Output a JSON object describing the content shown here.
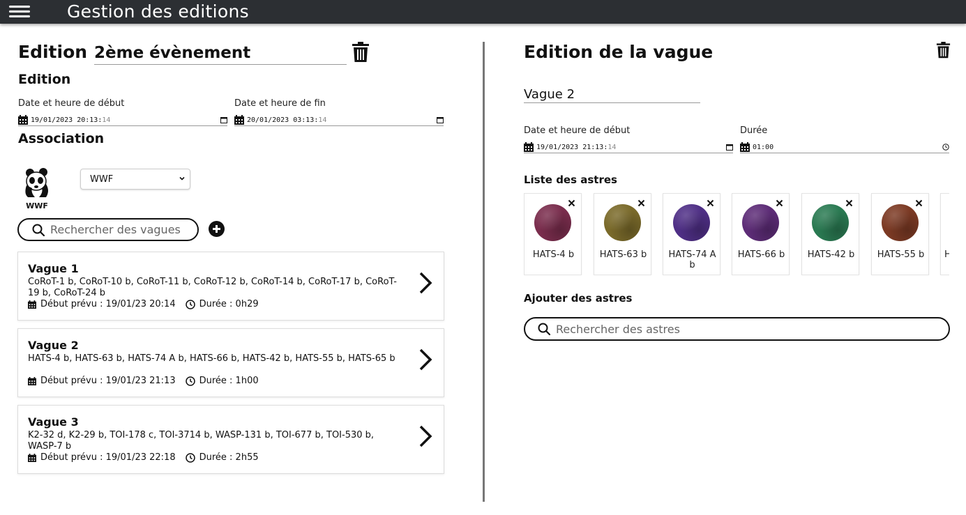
{
  "header": {
    "title": "Gestion des editions"
  },
  "edition": {
    "heading": "Edition",
    "name_value": "2ème évènement",
    "sub_heading": "Edition",
    "start_label": "Date et heure de début",
    "start_value": "19/01/2023 20:13:",
    "start_seconds": "14",
    "end_label": "Date et heure de fin",
    "end_value": "20/01/2023 03:13:",
    "end_seconds": "14"
  },
  "association": {
    "heading": "Association",
    "logo_text": "WWF",
    "selected": "WWF"
  },
  "wave_search": {
    "placeholder": "Rechercher des vagues"
  },
  "waves": [
    {
      "title": "Vague 1",
      "astres": "CoRoT-1 b, CoRoT-10 b, CoRoT-11 b, CoRoT-12 b, CoRoT-14 b, CoRoT-17 b, CoRoT-19 b, CoRoT-24 b",
      "start": "Début prévu : 19/01/23 20:14",
      "duration": "Durée : 0h29"
    },
    {
      "title": "Vague 2",
      "astres": "HATS-4 b, HATS-63 b, HATS-74 A b, HATS-66 b, HATS-42 b, HATS-55 b, HATS-65 b",
      "start": "Début prévu : 19/01/23 21:13",
      "duration": "Durée : 1h00"
    },
    {
      "title": "Vague 3",
      "astres": "K2-32 d, K2-29 b, TOI-178 c, TOI-3714 b, WASP-131 b, TOI-677 b, TOI-530 b, WASP-7 b",
      "start": "Début prévu : 19/01/23 22:18",
      "duration": "Durée : 2h55"
    }
  ],
  "wave_edit": {
    "heading": "Edition de la vague",
    "name_value": "Vague 2",
    "start_label": "Date et heure de début",
    "start_value": "19/01/2023 21:13:",
    "start_seconds": "14",
    "duration_label": "Durée",
    "duration_value": "01:00",
    "astres_heading": "Liste des astres",
    "add_heading": "Ajouter des astres",
    "astre_search_placeholder": "Rechercher des astres"
  },
  "astres": [
    {
      "name": "HATS-4 b",
      "color": "#7a2d4d"
    },
    {
      "name": "HATS-63 b",
      "color": "#7a6a2a"
    },
    {
      "name": "HATS-74 A b",
      "color": "#4f2f86"
    },
    {
      "name": "HATS-66 b",
      "color": "#5d2c77"
    },
    {
      "name": "HATS-42 b",
      "color": "#2a7a52"
    },
    {
      "name": "HATS-55 b",
      "color": "#7c3a24"
    },
    {
      "name": "H",
      "color": "#666666"
    }
  ]
}
